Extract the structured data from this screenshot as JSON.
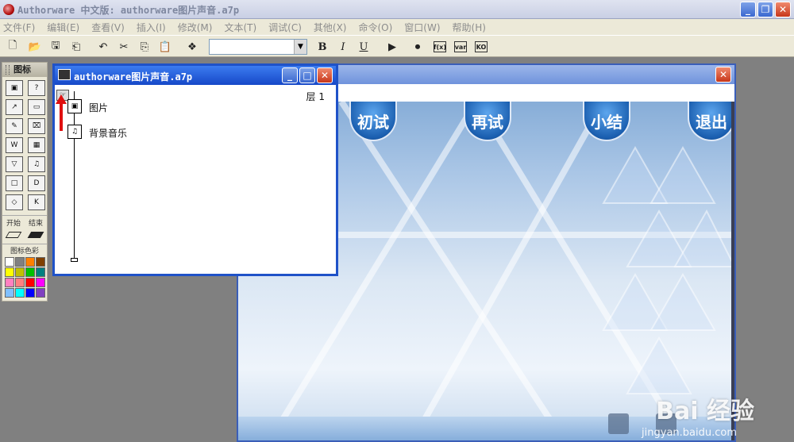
{
  "app": {
    "title": "Authorware 中文版: authorware图片声音.a7p"
  },
  "menu": [
    "文件(F)",
    "编辑(E)",
    "查看(V)",
    "插入(I)",
    "修改(M)",
    "文本(T)",
    "调试(C)",
    "其他(X)",
    "命令(O)",
    "窗口(W)",
    "帮助(H)"
  ],
  "toolbar": {
    "buttons": [
      "new-icon",
      "open-icon",
      "save-all-icon",
      "import-icon",
      "undo-icon",
      "cut-icon",
      "copy-icon",
      "paste-icon",
      "find-icon"
    ],
    "bold": "B",
    "italic": "I",
    "underline": "U",
    "run_icon": "run-icon",
    "control_icon": "control-panel-icon",
    "fx": "f(x)",
    "var": "var",
    "ko": "KO"
  },
  "palette": {
    "title": "图标",
    "start_label": "开始",
    "end_label": "结束",
    "color_label": "图标色彩",
    "icons": [
      "display",
      "wait",
      "calc",
      "?",
      "motion",
      "erase",
      "interaction",
      "map",
      "WAIT",
      "video",
      "decision",
      "navigate",
      "framework",
      "DVD",
      "sound",
      "KO"
    ],
    "colors": [
      "#ffffff",
      "#808080",
      "#ff8000",
      "#804000",
      "#ffff00",
      "#c0c000",
      "#00c000",
      "#008080",
      "#ff80c0",
      "#ff8080",
      "#ff0000",
      "#ff00ff",
      "#80c0ff",
      "#00ffff",
      "#0000ff",
      "#8040c0"
    ]
  },
  "flow_window": {
    "title": "authorware图片声音.a7p",
    "layer_label": "层 1",
    "nodes": [
      {
        "label": "图片"
      },
      {
        "label": "背景音乐"
      }
    ]
  },
  "presentation": {
    "buttons": [
      "初试",
      "再试",
      "小结",
      "退出"
    ]
  },
  "watermark": {
    "text": "Bai 经验",
    "sub": "jingyan.baidu.com"
  }
}
